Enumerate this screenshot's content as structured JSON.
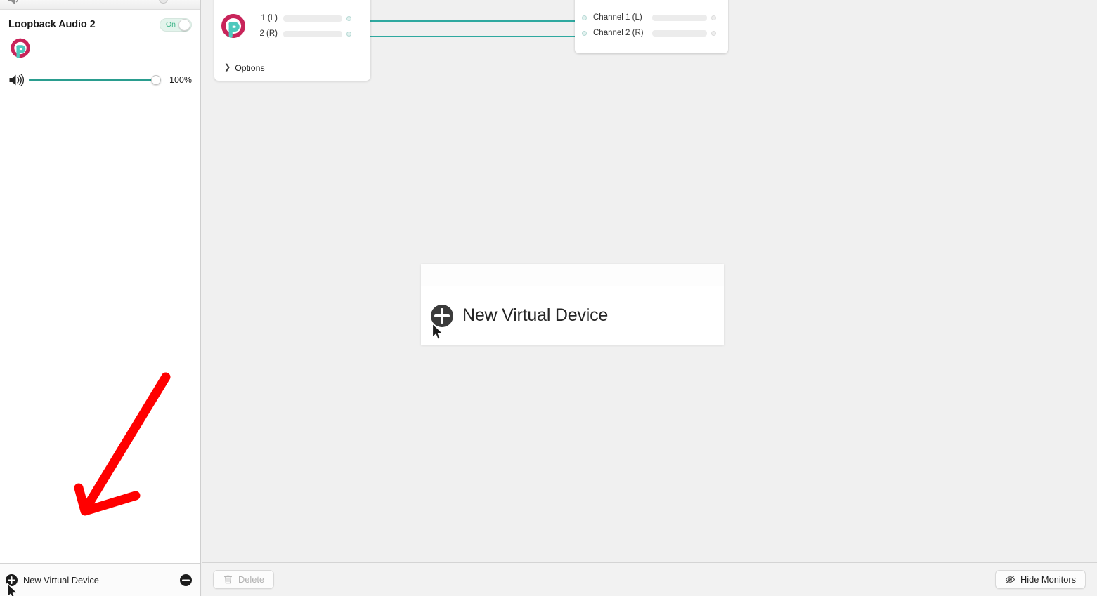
{
  "app": {
    "name": "Loopback",
    "accent_teal": "#2a9d8f",
    "accent_crimson": "#c8245a",
    "canvas_bg": "#f0f0f0",
    "sidebar_bg": "#ffffff"
  },
  "sidebar": {
    "cut_off_row": {
      "icon": "speaker-icon",
      "slider_visible": true
    },
    "device": {
      "title": "Loopback Audio 2",
      "toggle": {
        "label": "On",
        "state": "on"
      },
      "logo_icon": "loopback-logo-icon",
      "volume": {
        "icon": "speaker-icon",
        "value_label": "100%",
        "percent": 100
      }
    },
    "footer": {
      "add_icon": "plus-circle-icon",
      "label": "New Virtual Device",
      "remove_icon": "minus-circle-icon"
    }
  },
  "canvas": {
    "source_node": {
      "logo_icon": "loopback-logo-icon",
      "channels": [
        {
          "label": "1 (L)",
          "meter_level": 0,
          "port": "output-port"
        },
        {
          "label": "2 (R)",
          "meter_level": 0,
          "port": "output-port"
        }
      ],
      "options": {
        "disclosure_icon": "chevron-right-icon",
        "label": "Options"
      }
    },
    "output_node": {
      "channels": [
        {
          "label": "Channel 1 (L)",
          "meter_level": 0,
          "port": "input-port"
        },
        {
          "label": "Channel 2 (R)",
          "meter_level": 0,
          "port": "input-port"
        }
      ]
    },
    "cables": [
      {
        "from": "source-1",
        "to": "channel-1",
        "color": "#2fa9a0"
      },
      {
        "from": "source-2",
        "to": "channel-2",
        "color": "#2fa9a0"
      }
    ]
  },
  "popup": {
    "empty_section_visible": true,
    "items": [
      {
        "icon": "plus-circle-icon",
        "label": "New Virtual Device"
      }
    ]
  },
  "annotation": {
    "type": "arrow",
    "color": "#ff0000",
    "direction": "down-left",
    "points_to": "New Virtual Device"
  },
  "toolbar": {
    "delete": {
      "icon": "trash-icon",
      "label": "Delete",
      "enabled": false
    },
    "hide_monitors": {
      "icon": "eye-slash-icon",
      "label": "Hide Monitors",
      "enabled": true
    }
  }
}
